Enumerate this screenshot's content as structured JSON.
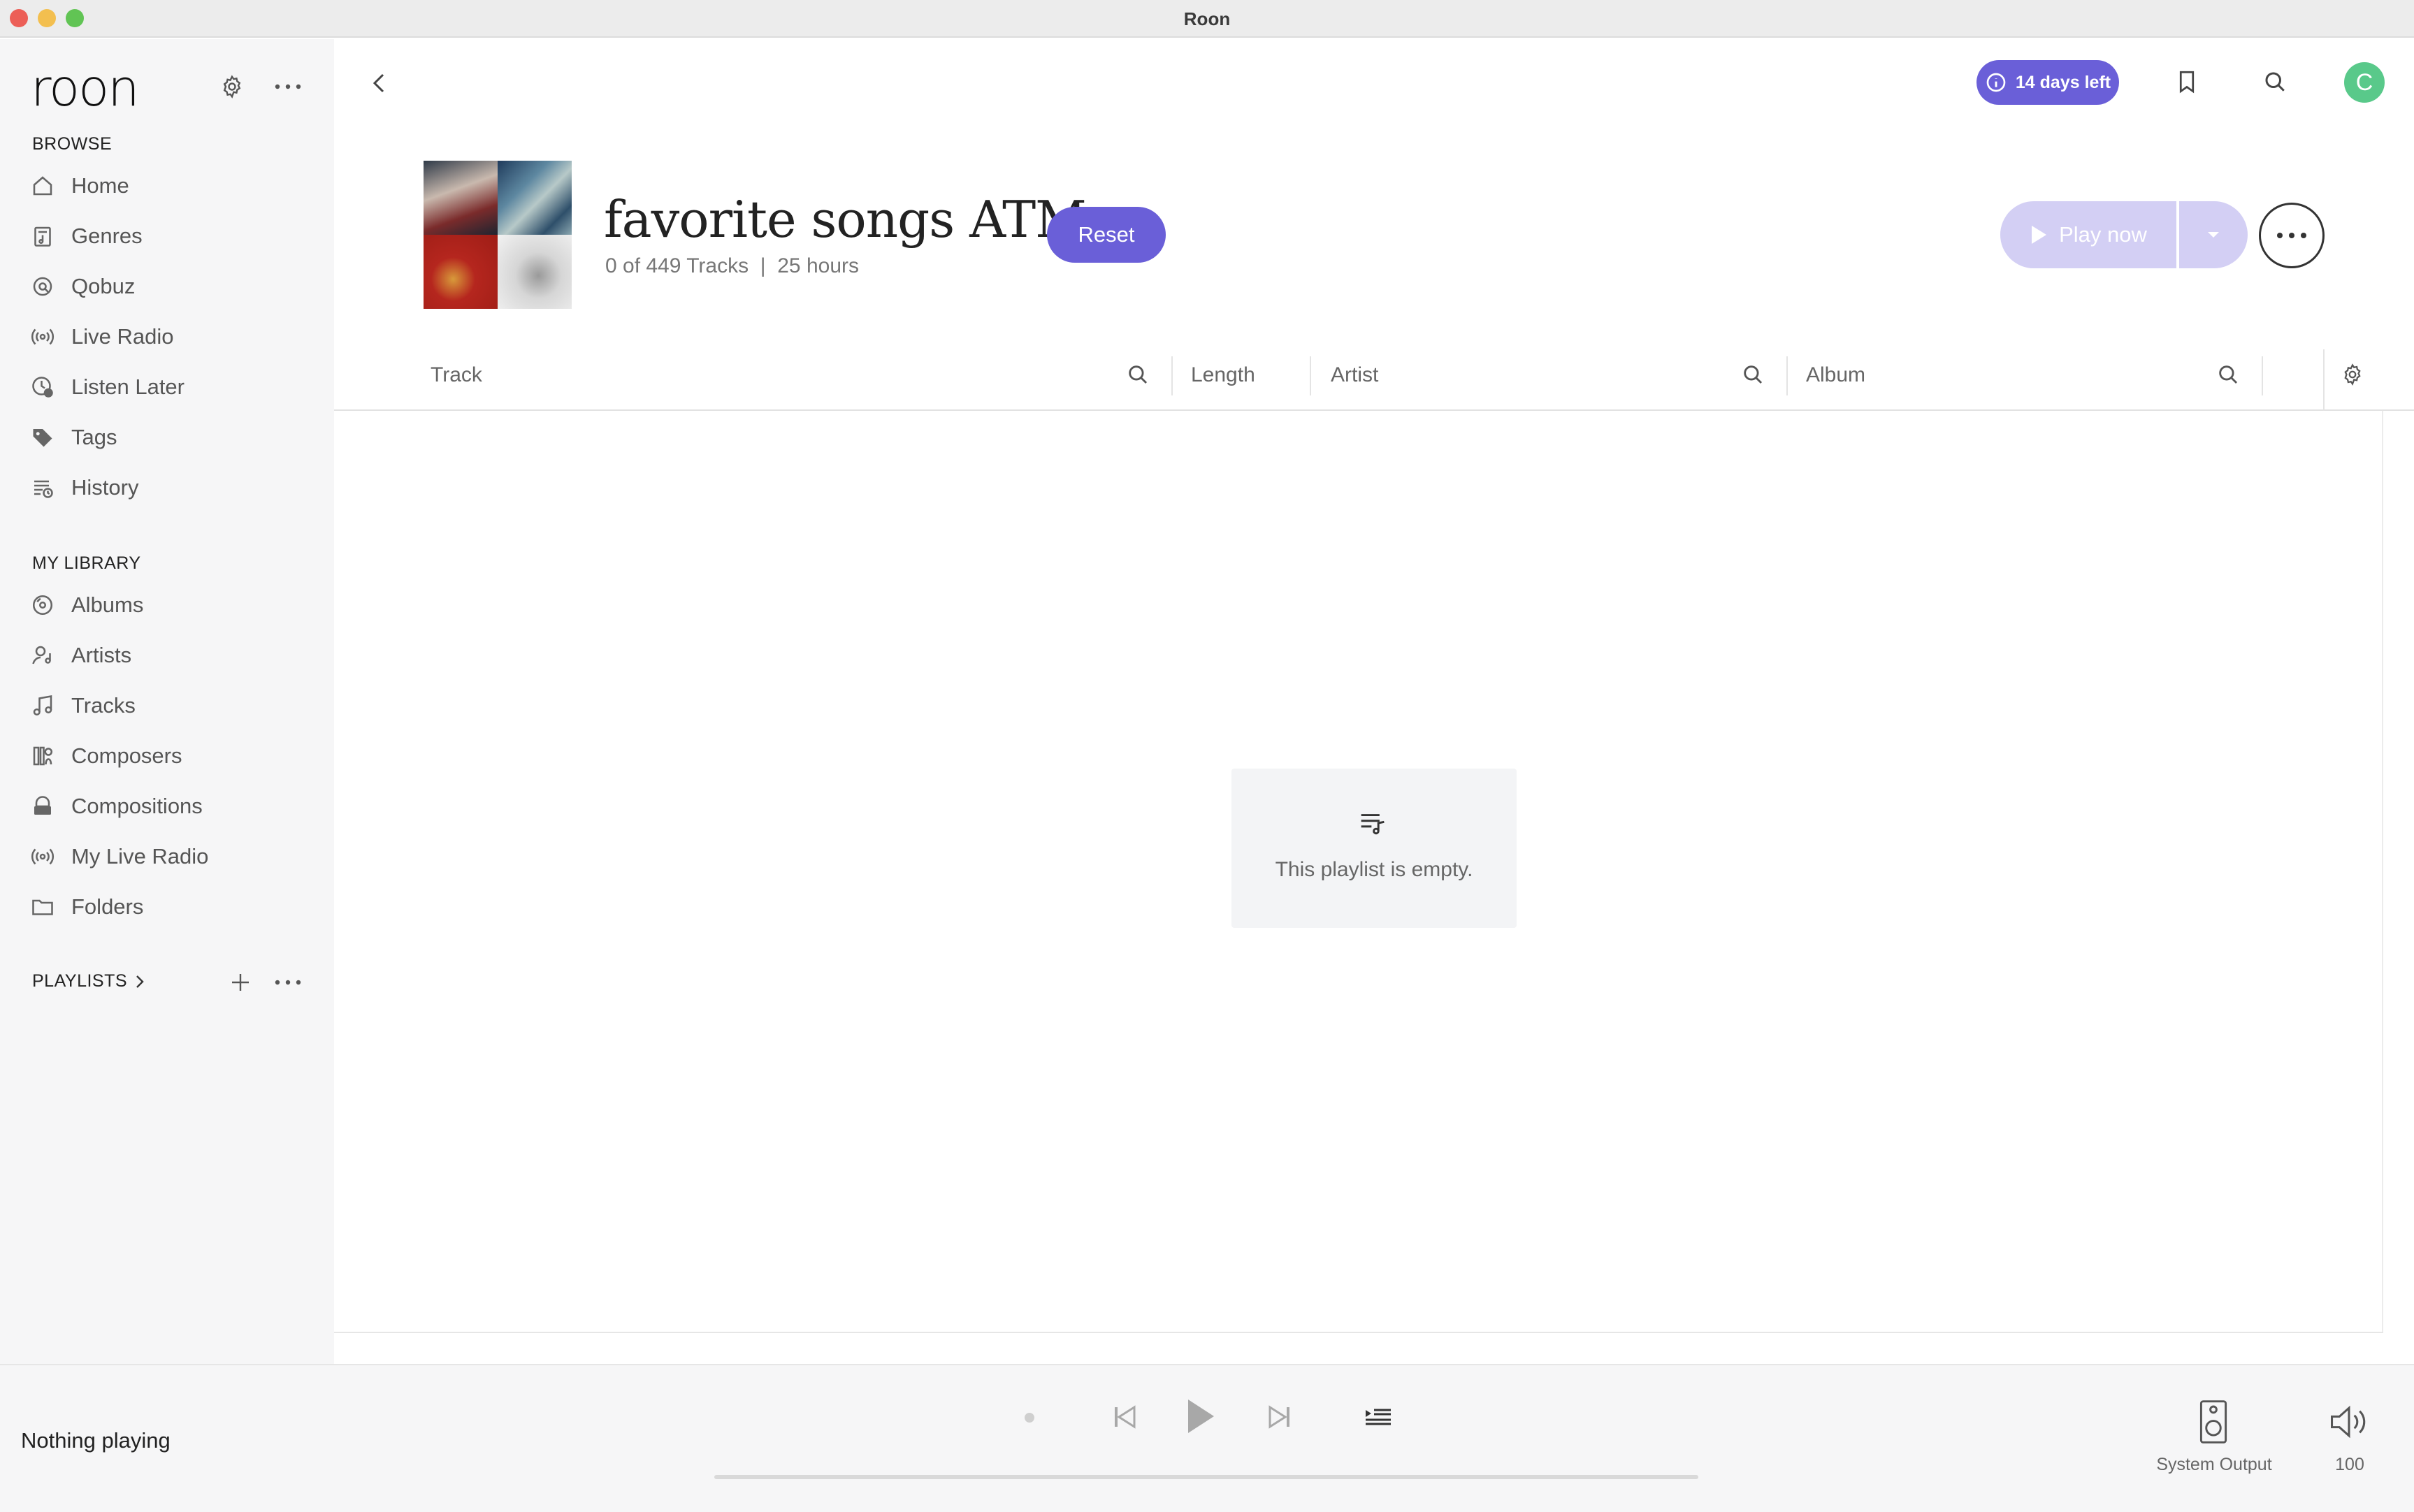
{
  "window": {
    "title": "Roon"
  },
  "sidebar": {
    "logo": "roon",
    "browse_heading": "BROWSE",
    "browse_items": [
      {
        "label": "Home",
        "icon": "home-icon"
      },
      {
        "label": "Genres",
        "icon": "genres-icon"
      },
      {
        "label": "Qobuz",
        "icon": "qobuz-icon"
      },
      {
        "label": "Live Radio",
        "icon": "radio-icon"
      },
      {
        "label": "Listen Later",
        "icon": "clock-icon"
      },
      {
        "label": "Tags",
        "icon": "tag-icon"
      },
      {
        "label": "History",
        "icon": "history-icon"
      }
    ],
    "library_heading": "MY LIBRARY",
    "library_items": [
      {
        "label": "Albums",
        "icon": "album-icon"
      },
      {
        "label": "Artists",
        "icon": "artist-icon"
      },
      {
        "label": "Tracks",
        "icon": "music-note-icon"
      },
      {
        "label": "Composers",
        "icon": "composer-icon"
      },
      {
        "label": "Compositions",
        "icon": "composition-icon"
      },
      {
        "label": "My Live Radio",
        "icon": "radio-icon"
      },
      {
        "label": "Folders",
        "icon": "folder-icon"
      }
    ],
    "playlists_heading": "PLAYLISTS"
  },
  "header": {
    "trial_badge": "14 days left",
    "avatar_initial": "C"
  },
  "playlist": {
    "title": "favorite songs ATM",
    "meta": "0 of 449 Tracks  |  25 hours",
    "reset_label": "Reset",
    "play_now_label": "Play now"
  },
  "table": {
    "columns": [
      "Track",
      "Length",
      "Artist",
      "Album"
    ]
  },
  "empty_state": {
    "message": "This playlist is empty."
  },
  "player": {
    "now_playing": "Nothing playing",
    "output_label": "System Output",
    "volume": "100",
    "progress": 0
  },
  "colors": {
    "accent": "#6a5fd8",
    "accent_disabled": "#d3cff4",
    "avatar": "#59c98a",
    "sidebar_bg": "#f6f6f7"
  }
}
